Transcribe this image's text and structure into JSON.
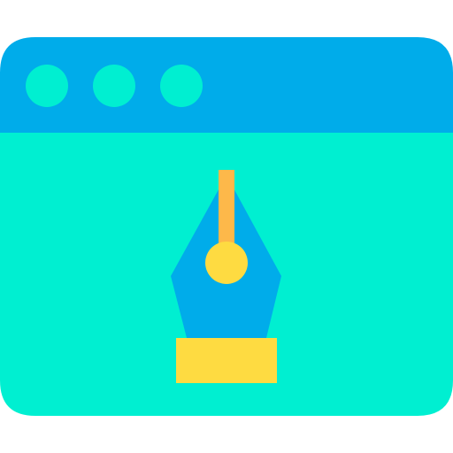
{
  "icon": {
    "name": "web-design-pen-tool-icon",
    "colors": {
      "background": "#ffffff",
      "title_bar": "#00acea",
      "window_body": "#00efd1",
      "window_dots": "#00efd1",
      "pen_nib": "#00acea",
      "pen_slit": "#fdb84a",
      "pen_hole": "#fedb41",
      "pen_base": "#fedb41"
    },
    "window_dot_count": 3
  }
}
